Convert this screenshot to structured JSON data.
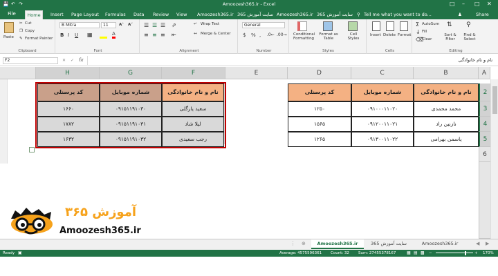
{
  "app": {
    "title": "Amoozesh365.ir - Excel"
  },
  "tabs": {
    "file": "File",
    "items": [
      "Home",
      "Insert",
      "Page Layout",
      "Formulas",
      "Data",
      "Review",
      "View",
      "Amoozesh365.ir",
      "365 سایت آموزش",
      "Amoozesh365.ir",
      "سایت آموزش 365"
    ],
    "tell_me": "Tell me what you want to do...",
    "user": "",
    "share": "Share"
  },
  "ribbon": {
    "clipboard": {
      "label": "Clipboard",
      "paste": "Paste",
      "cut": "Cut",
      "copy": "Copy",
      "format_painter": "Format Painter"
    },
    "font": {
      "label": "Font",
      "name": "B Mitra",
      "size": "11"
    },
    "alignment": {
      "label": "Alignment",
      "wrap": "Wrap Text",
      "merge": "Merge & Center"
    },
    "number": {
      "label": "Number",
      "format": "General",
      "dollar": "$",
      "percent": "%",
      "comma": ","
    },
    "styles": {
      "label": "Styles",
      "conditional": "Conditional Formatting",
      "format_table": "Format as Table",
      "cell_styles": "Cell Styles"
    },
    "cells": {
      "label": "Cells",
      "insert": "Insert",
      "delete": "Delete",
      "format": "Format"
    },
    "editing": {
      "label": "Editing",
      "autosum": "AutoSum",
      "fill": "Fill",
      "clear": "Clear",
      "sort": "Sort & Filter",
      "find": "Find & Select"
    }
  },
  "formula_bar": {
    "name_box": "F2",
    "content": "نام و نام خانوادگی"
  },
  "grid": {
    "columns": [
      "H",
      "G",
      "F",
      "E",
      "D",
      "C",
      "B",
      "A"
    ],
    "rows": [
      "2",
      "3",
      "4",
      "5",
      "6"
    ],
    "right_table": {
      "headers": [
        "کد پرسنلی",
        "شماره موبایل",
        "نام و نام خانوادگی"
      ],
      "rows": [
        [
          "۱۲۵۰",
          "۰۹۱۰۰۰۱۱۰۲۰",
          "محمد محمدی"
        ],
        [
          "۱۵۶۵",
          "۰۹۱۲۰۰۱۱۰۲۱",
          "نازنین راد"
        ],
        [
          "۱۲۶۵",
          "۰۹۱۳۰۰۱۱۰۲۲",
          "یاسمن بهرامی"
        ]
      ]
    },
    "left_table": {
      "headers": [
        "کد پرسنلی",
        "شماره موبایل",
        "نام و نام خانوادگی"
      ],
      "rows": [
        [
          "۱۶۶۰",
          "۰۹۱۵۱۱۹۱۰۳۰",
          "سعید یارگلی"
        ],
        [
          "۱۷۸۲",
          "۰۹۱۵۱۱۹۱۰۳۱",
          "لیلا شاد"
        ],
        [
          "۱۶۳۲",
          "۰۹۱۵۱۱۹۱۰۳۲",
          "رجب سعیدی"
        ]
      ]
    }
  },
  "logo": {
    "text_fa": "آموزش ۳۶۵",
    "site": "Amoozesh365.ir"
  },
  "sheet_tabs": [
    "Amoozesh365.ir",
    "365 سایت آموزش",
    "Amoozesh365.ir"
  ],
  "status": {
    "ready": "Ready",
    "average": "Average: 4575596361",
    "count": "Count: 32",
    "sum": "Sum: 27455378167",
    "zoom": "170%"
  },
  "colors": {
    "excel_green": "#217346",
    "header_fill": "#f4b183",
    "selection_fill": "#d9d9d9",
    "selection_border": "#c00000",
    "logo_orange": "#f6a21b"
  }
}
